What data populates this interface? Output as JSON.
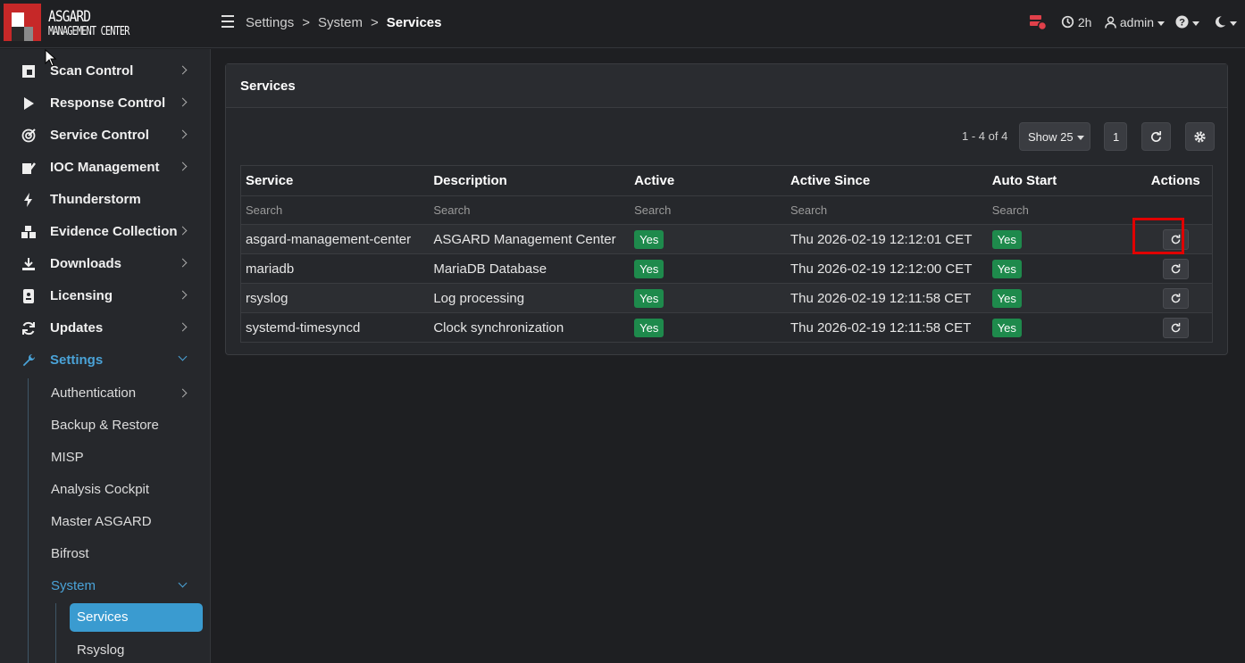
{
  "brand": {
    "line1": "ASGARD",
    "line2": "MANAGEMENT CENTER"
  },
  "breadcrumb": [
    "Settings",
    "System",
    "Services"
  ],
  "topbar": {
    "timer": "2h",
    "user": "admin"
  },
  "sidebar": {
    "items": [
      {
        "label": "Scan Control",
        "icon": "scan-icon"
      },
      {
        "label": "Response Control",
        "icon": "play-icon"
      },
      {
        "label": "Service Control",
        "icon": "target-icon"
      },
      {
        "label": "IOC Management",
        "icon": "edit-icon"
      },
      {
        "label": "Thunderstorm",
        "icon": "bolt-icon"
      },
      {
        "label": "Evidence Collection",
        "icon": "boxes-icon"
      },
      {
        "label": "Downloads",
        "icon": "download-icon"
      },
      {
        "label": "Licensing",
        "icon": "id-card-icon"
      },
      {
        "label": "Updates",
        "icon": "sync-icon"
      },
      {
        "label": "Settings",
        "icon": "wrench-icon"
      }
    ],
    "settings_sub": [
      "Authentication",
      "Backup & Restore",
      "MISP",
      "Analysis Cockpit",
      "Master ASGARD",
      "Bifrost",
      "System"
    ],
    "system_sub": [
      "Services",
      "Rsyslog"
    ]
  },
  "card": {
    "title": "Services",
    "range": "1 - 4 of 4",
    "show": "Show 25",
    "page": "1",
    "columns": [
      "Service",
      "Description",
      "Active",
      "Active Since",
      "Auto Start",
      "Actions"
    ],
    "search_placeholder": "Search",
    "rows": [
      {
        "service": "asgard-management-center",
        "description": "ASGARD Management Center",
        "active": "Yes",
        "since": "Thu 2026-02-19 12:12:01 CET",
        "auto": "Yes"
      },
      {
        "service": "mariadb",
        "description": "MariaDB Database",
        "active": "Yes",
        "since": "Thu 2026-02-19 12:12:00 CET",
        "auto": "Yes"
      },
      {
        "service": "rsyslog",
        "description": "Log processing",
        "active": "Yes",
        "since": "Thu 2026-02-19 12:11:58 CET",
        "auto": "Yes"
      },
      {
        "service": "systemd-timesyncd",
        "description": "Clock synchronization",
        "active": "Yes",
        "since": "Thu 2026-02-19 12:11:58 CET",
        "auto": "Yes"
      }
    ]
  },
  "colors": {
    "accent": "#3a9bd0",
    "success": "#1e8a4c",
    "brand": "#c62828",
    "highlight": "#e00000"
  }
}
